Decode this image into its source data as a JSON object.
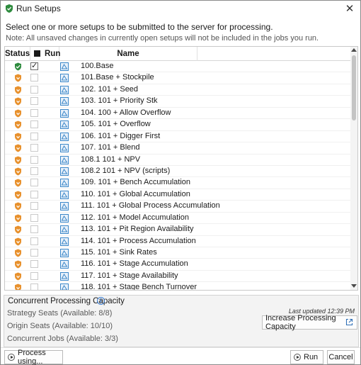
{
  "window": {
    "title": "Run Setups",
    "close_glyph": "✕"
  },
  "instructions": "Select one or more setups to be submitted to the server for processing.",
  "note": "Note: All unsaved changes in currently open setups will not be included in the jobs you run.",
  "table": {
    "headers": {
      "status": "Status",
      "run": "Run",
      "name": "Name"
    },
    "rows": [
      {
        "name": "100.Base",
        "status": "valid",
        "checked": true
      },
      {
        "name": "101.Base + Stockpile",
        "status": "warning",
        "checked": false
      },
      {
        "name": "102. 101 + Seed",
        "status": "warning",
        "checked": false
      },
      {
        "name": "103. 101 + Priority Stk",
        "status": "warning",
        "checked": false
      },
      {
        "name": "104. 100 + Allow Overflow",
        "status": "warning",
        "checked": false
      },
      {
        "name": "105. 101 + Overflow",
        "status": "warning",
        "checked": false
      },
      {
        "name": "106. 101 + Digger First",
        "status": "warning",
        "checked": false
      },
      {
        "name": "107. 101 + Blend",
        "status": "warning",
        "checked": false
      },
      {
        "name": "108.1 101 + NPV",
        "status": "warning",
        "checked": false
      },
      {
        "name": "108.2 101 + NPV (scripts)",
        "status": "warning",
        "checked": false
      },
      {
        "name": "109. 101 + Bench Accumulation",
        "status": "warning",
        "checked": false
      },
      {
        "name": "110. 101 + Global Accumulation",
        "status": "warning",
        "checked": false
      },
      {
        "name": "111. 101 + Global Process Accumulation",
        "status": "warning",
        "checked": false
      },
      {
        "name": "112. 101 + Model Accumulation",
        "status": "warning",
        "checked": false
      },
      {
        "name": "113. 101 + Pit Region Availability",
        "status": "warning",
        "checked": false
      },
      {
        "name": "114. 101 + Process Accumulation",
        "status": "warning",
        "checked": false
      },
      {
        "name": "115. 101 + Sink Rates",
        "status": "warning",
        "checked": false
      },
      {
        "name": "116. 101 + Stage Accumulation",
        "status": "warning",
        "checked": false
      },
      {
        "name": "117. 101 + Stage Availability",
        "status": "warning",
        "checked": false
      },
      {
        "name": "118. 101 + Stage Bench Turnover",
        "status": "warning",
        "checked": false
      }
    ]
  },
  "capacity": {
    "title": "Concurrent Processing Capacity",
    "info_glyph": "i",
    "strategy_seats": "Strategy Seats (Available: 8/8)",
    "origin_seats": "Origin Seats (Available: 10/10)",
    "concurrent_jobs": "Concurrent Jobs (Available: 3/3)",
    "last_updated": "Last updated 12:39 PM",
    "increase_label": "Increase Processing Capacity"
  },
  "footer": {
    "process_using": "Process using...",
    "run": "Run",
    "cancel": "Cancel"
  },
  "colors": {
    "valid_shield": "#2e8b3e",
    "warning_shield": "#e8912d",
    "setup_icon": "#3a86c8"
  },
  "icons": {
    "valid": "shield-check-icon",
    "warning": "shield-warning-icon",
    "setup": "setup-file-icon"
  }
}
